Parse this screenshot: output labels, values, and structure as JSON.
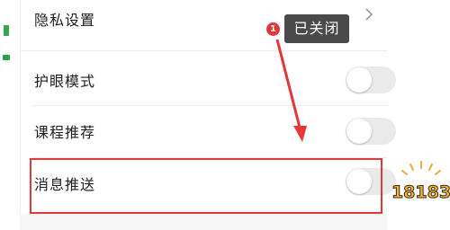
{
  "settings": {
    "items": [
      {
        "label": "隐私设置",
        "control": "chevron"
      },
      {
        "label": "护眼模式",
        "control": "toggle",
        "on": false
      },
      {
        "label": "课程推荐",
        "control": "toggle",
        "on": false
      },
      {
        "label": "消息推送",
        "control": "toggle",
        "on": false
      }
    ]
  },
  "annotation": {
    "step_number": "1",
    "tooltip": "已关闭",
    "highlight_color": "#e03a3a"
  },
  "watermark": {
    "text": "18183"
  },
  "colors": {
    "toggle_off": "#eaeaea",
    "tooltip_bg": "#4a4a4a",
    "badge": "#e23838"
  }
}
